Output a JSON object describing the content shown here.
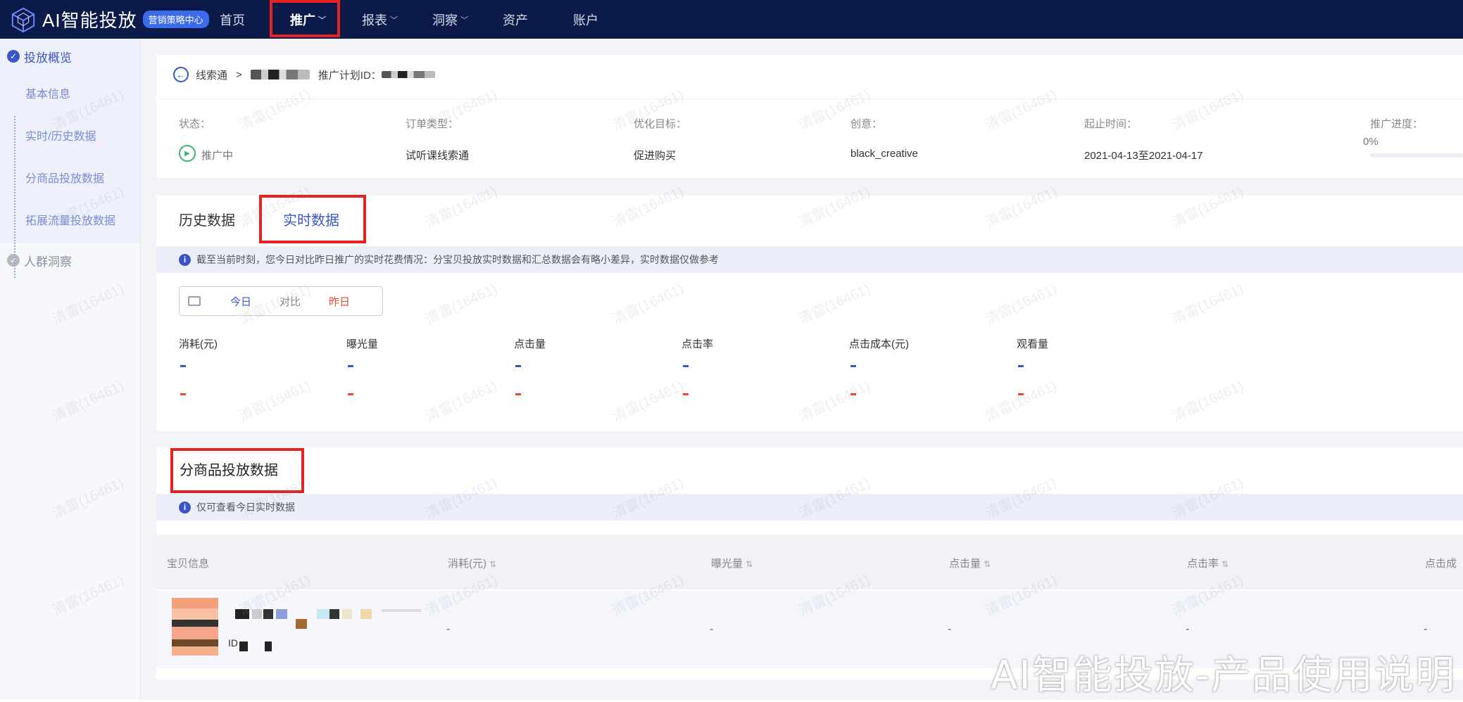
{
  "topnav": {
    "logo_text": "AI智能投放",
    "logo_badge": "营销策略中心",
    "items": [
      {
        "label": "首页",
        "has_dropdown": false
      },
      {
        "label": "推广",
        "has_dropdown": true,
        "active": true
      },
      {
        "label": "报表",
        "has_dropdown": true
      },
      {
        "label": "洞察",
        "has_dropdown": true
      },
      {
        "label": "资产",
        "has_dropdown": false
      },
      {
        "label": "账户",
        "has_dropdown": false
      }
    ]
  },
  "sidebar": {
    "section1": "投放概览",
    "sub_items": [
      "基本信息",
      "实时/历史数据",
      "分商品投放数据",
      "拓展流量投放数据"
    ],
    "section2": "人群洞察"
  },
  "breadcrumb": {
    "parent": "线索通",
    "separator": ">",
    "plan_id_label": "推广计划ID："
  },
  "plan_info": {
    "labels": [
      "状态：",
      "订单类型：",
      "优化目标：",
      "创意：",
      "起止时间：",
      "推广进度："
    ],
    "status": "推广中",
    "order_type": "试听课线索通",
    "optimization_goal": "促进购买",
    "creative": "black_creative",
    "date_range": "2021-04-13至2021-04-17",
    "progress": "0%",
    "progress_value": 0
  },
  "tabs": [
    "历史数据",
    "实时数据"
  ],
  "realtime_notice": "截至当前时刻，您今日对比昨日推广的实时花费情况：分宝贝投放实时数据和汇总数据会有略小差异，实时数据仅做参考",
  "segment": {
    "today": "今日",
    "compare": "对比",
    "yesterday": "昨日"
  },
  "metrics": [
    "消耗(元)",
    "曝光量",
    "点击量",
    "点击率",
    "点击成本(元)",
    "观看量"
  ],
  "metric_values": {
    "today": "-",
    "yesterday": "-"
  },
  "product_section": {
    "title": "分商品投放数据",
    "notice": "仅可查看今日实时数据",
    "columns": [
      "宝贝信息",
      "消耗(元)",
      "曝光量",
      "点击量",
      "点击率",
      "点击成"
    ],
    "sort_icon": "⇅",
    "row": {
      "id_label": "ID",
      "values": [
        "-",
        "-",
        "-",
        "-",
        "-"
      ]
    }
  },
  "watermark_text": "清雷(16461)",
  "footer_title": "AI智能投放-产品使用说明",
  "colors": {
    "nav_bg": "#0c1a4a",
    "accent": "#3a55c7",
    "highlight_box": "#e42222",
    "yesterday": "#e8472e"
  }
}
